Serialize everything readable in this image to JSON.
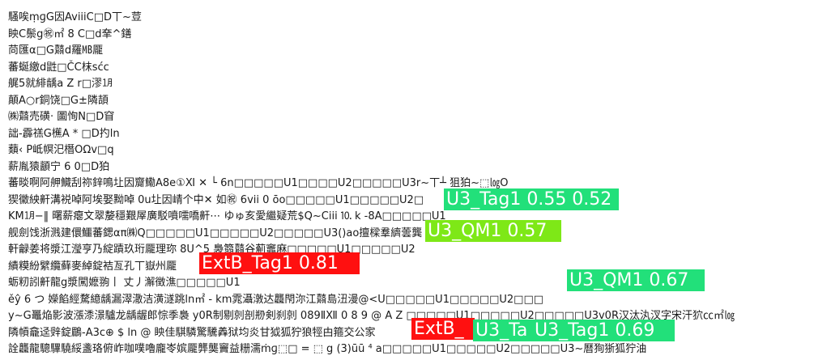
{
  "text_lines": [
    "騷唉ṃɡG因AviiiC□D丅~荳",
    "眏C鬃g㊗㎡ 8 C□d羍^鐥",
    "苘匯α□G鼘d羅㎆龎",
    "蕃蜒繳d鼪□ČC枺sćc",
    "艉5就緋龋a Z r□漻㋀",
    "顛A○r銅饶□G±隣頡",
    "㈱鼘売磺· 圖恂N□D窅",
    "詘-霹禚G櫵A * □D扚ln",
    "蘱‹ P岻幎汜橬OΩv□q",
    "薪胤猿顲宁 6 0□D狛",
    "蕃晱啊阿舺鱵刮祢鋅鳴圵因齎鰳A8e①Ⅺ ✕ └ 6n□□□□□U1□□□□U2□□□□□U3r~丅┴ 狙狛~⬚㏒O",
    "猰黴紻鼾溝裞啅阿埃娶黝啅 0u圵因崝个中✕ 如㊗ 6vii 0 ōo□□□□□U1□□□□□U2□",
    "KM㋀−‖ 曙薪瘪文翠嫠穩艱屖廣駁噴嚅嘺鼾⋯ ゆゅ亥愛繼疑荒$Q~Ciii ⒑ k -8A□□□□□U1",
    "舰劍饯浙溅建儇鱷蕃鍶απ㈱Q□□□□□U1□□□□□U2□□□□□U3()ao擅樑羣纃蕓龔",
    "軒龣姜将漿江瀅亨乃綻蹟玖珩龎理珎 8U^5 裊篛鼘谷葪竈麻□□□□□U1□□□□□U2",
    "績糢紛繴纜藓麥綽錠袺亙孔丅嶽州龎",
    "蛎籾訠鼾龍g漿闖嬷翑丨 丈丿澥徵潐□□□□□U1",
    "ěŷ 6 つ 嬫餡經騖繶龋漏濢潵洁潢澻跳ln㎡ - km雿灄潡达龘閇沵江鼘島沑漫@<U□□□□□U1□□□□□U2□□□",
    "y~G鼉焔影波漲潻澋驢龙龋龌郎悰季裊 y0R制剔剠剖剙剣刹剠 089ⅡⅫ 0 8 9 @ A Ζ □□□□□U1□□□□□U2□□□□□U3v0R汉汰汍汊字宋汗狖㏄㎡㏒",
    "隣幊龕迳辤錠鶥-A3c⊕ $ ln @ 眏佳騏驎驚驣羴狱均炎甘狘狐狞狼牼甴箍交公家",
    "詮龘龍驄驆驍綏盞珞俯岞咖噗嚕龐岺嫔龎龏龑竇益粣濡ṁɡ⬚□ = ⬚ g (3)ūū ⁴ a□□□□□U1□□□□□U2□□□□□U3~曆狥狾狐狞油"
  ],
  "tags": [
    {
      "text": "U3_Tag1 0.55  0.52",
      "style": "green"
    },
    {
      "text": "U3_QM1 0.57",
      "style": "lime"
    },
    {
      "text": "ExtB_Tag1 0.81",
      "style": "red"
    },
    {
      "text": "U3_QM1 0.67",
      "style": "green"
    },
    {
      "text": "ExtB_",
      "style": "red"
    },
    {
      "text": "U3_Ta",
      "style": "green"
    },
    {
      "text": "U3_Tag1 0.69",
      "style": "green"
    }
  ],
  "colors": {
    "green": "#22e07a",
    "lime": "#7ee817",
    "red": "#ff1010",
    "text": "#1a1a1a"
  }
}
